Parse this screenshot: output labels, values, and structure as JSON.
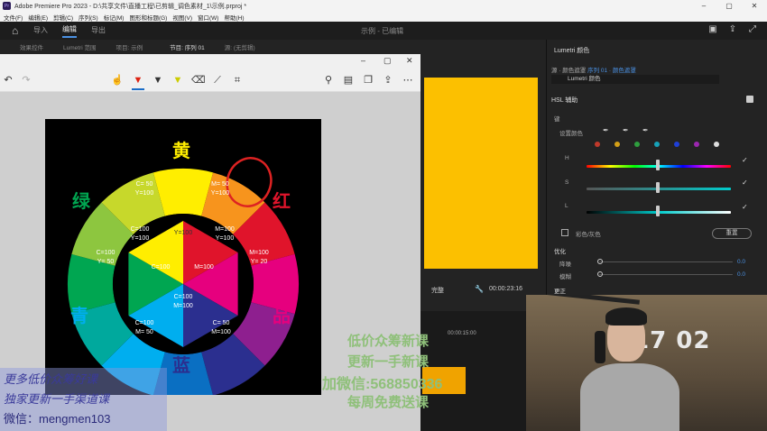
{
  "titlebar": {
    "logo": "Pr",
    "text": "Adobe Premiere Pro 2023 - D:\\共享文件\\直播工程\\已剪辑_调色素材_1\\示例.prproj *",
    "min": "–",
    "max": "▢",
    "close": "✕"
  },
  "menu": [
    "文件(F)",
    "编辑(E)",
    "剪辑(C)",
    "序列(S)",
    "标记(M)",
    "图形和标题(G)",
    "视图(V)",
    "窗口(W)",
    "帮助(H)"
  ],
  "workspace": {
    "tabs": [
      "导入",
      "编辑",
      "导出"
    ],
    "active": "编辑",
    "center_title": "示例 - 已编辑"
  },
  "panel_tabs": [
    "效果控件",
    "Lumetri 范围",
    "项目: 示例",
    "节目: 序列 01",
    "源: (无剪辑)"
  ],
  "colorwheel": {
    "labels": {
      "yellow": "黄",
      "red": "红",
      "magenta": "品",
      "blue": "蓝",
      "cyan": "青",
      "green": "绿"
    },
    "outer": {
      "top_left": [
        "C= 50",
        "Y=100"
      ],
      "top_right": [
        "M= 50",
        "Y=100"
      ],
      "right": [
        "M=100",
        "Y= 20"
      ],
      "bottom_right": [
        "C= 50",
        "M=100"
      ],
      "bottom_left": [
        "C=100",
        "M= 50"
      ],
      "left": [
        "C=100",
        "Y= 50"
      ]
    },
    "inner": {
      "top_left": [
        "C=100",
        "Y=100"
      ],
      "top": "Y=100",
      "top_right": [
        "M=100",
        "Y=100"
      ],
      "left": "C=100",
      "right": "M=100",
      "bottom": [
        "C=100",
        "M=100"
      ]
    },
    "colors": {
      "yellow": "#ffee00",
      "orange": "#f7941d",
      "red": "#e0142b",
      "magenta": "#e6007e",
      "purple": "#8e1f8f",
      "blue": "#2b2f8f",
      "bluecyan": "#0a6fc2",
      "cyan": "#00aeef",
      "teal": "#00a99d",
      "green": "#00a651",
      "lime": "#8dc63f",
      "yellowgreen": "#c7d82b"
    }
  },
  "program": {
    "fit": "完整",
    "timecode": "00:00:23:16",
    "timeline_time": "00:00:15:00"
  },
  "lumetri": {
    "title": "Lumetri 颜色",
    "source_prefix": "源 · 颜色遮罩",
    "source_active": "序列 01 · 颜色遮罩",
    "dropdown": "Lumetri 颜色",
    "hsl": "HSL 辅助",
    "key": "键",
    "set_color": "设置颜色",
    "H": "H",
    "S": "S",
    "L": "L",
    "color_gray": "彩色/灰色",
    "reset": "重置",
    "refine": "优化",
    "denoise": "降噪",
    "blur": "模糊",
    "denoise_val": "0.0",
    "blur_val": "0.0",
    "correct": "更正",
    "dots": [
      "#c0392b",
      "#d4a017",
      "#2e9e3e",
      "#17a2b8",
      "#1f3fd6",
      "#9b27af",
      "#dddddd"
    ]
  },
  "webcam": {
    "clock": "17 02"
  },
  "watermarks": {
    "line1": "低价众筹新课",
    "line2": "更新一手新课",
    "line3": "加微信:568850336",
    "line4": "每周免费送课",
    "left1": "更多低价众筹好课",
    "left2": "独家更新一手渠道课",
    "left3": "微信：mengmen103"
  }
}
